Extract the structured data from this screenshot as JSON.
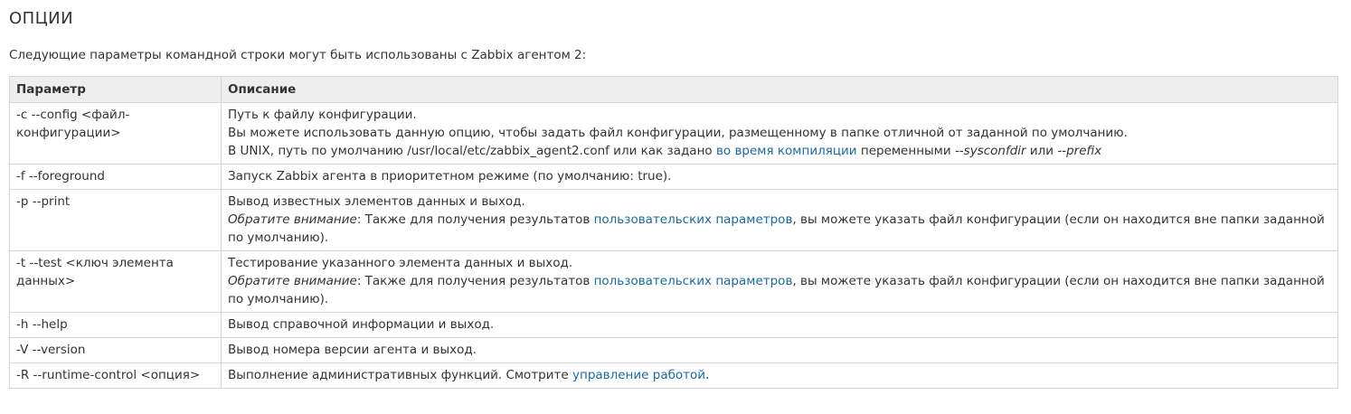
{
  "section": {
    "title": "ОПЦИИ",
    "intro": "Следующие параметры командной строки могут быть использованы с Zabbix агентом 2:"
  },
  "table": {
    "headers": [
      "Параметр",
      "Описание"
    ],
    "rows": [
      {
        "param": "-c --config <файл-конфигурации>",
        "desc1": "Путь к файлу конфигурации.",
        "desc2": "Вы можете использовать данную опцию, чтобы задать файл конфигурации, размещенному в папке отличной от заданной по умолчанию.",
        "desc3_pre": "В UNIX, путь по умолчанию /usr/local/etc/zabbix_agent2.conf или как задано ",
        "desc3_link": "во время компиляции",
        "desc3_mid": " переменными ",
        "desc3_em1": "--sysconfdir",
        "desc3_or": " или ",
        "desc3_em2": "--prefix"
      },
      {
        "param": "-f --foreground",
        "desc1": "Запуск Zabbix агента в приоритетном режиме (по умолчанию: true)."
      },
      {
        "param": "-p --print",
        "desc1": "Вывод известных элементов данных и выход.",
        "note_em": "Обратите внимание",
        "note_pre": ": Также для получения результатов ",
        "note_link": "пользовательских параметров",
        "note_post": ", вы можете указать файл конфигурации (если он находится вне папки заданной по умолчанию)."
      },
      {
        "param": "-t --test <ключ элемента данных>",
        "desc1": "Тестирование указанного элемента данных и выход.",
        "note_em": "Обратите внимание",
        "note_pre": ": Также для получения результатов ",
        "note_link": "пользовательских параметров",
        "note_post": ", вы можете указать файл конфигурации (если он находится вне папки заданной по умолчанию)."
      },
      {
        "param": "-h --help",
        "desc1": "Вывод справочной информации и выход."
      },
      {
        "param": "-V --version",
        "desc1": "Вывод номера версии агента и выход."
      },
      {
        "param": "-R --runtime-control <опция>",
        "desc_pre": "Выполнение административных функций. Смотрите ",
        "desc_link": "управление работой",
        "desc_post": "."
      }
    ]
  },
  "colors": {
    "link": "#1a6ba0",
    "text": "#333333",
    "header_bg": "#eeeeee",
    "border": "#d5d5d5"
  }
}
